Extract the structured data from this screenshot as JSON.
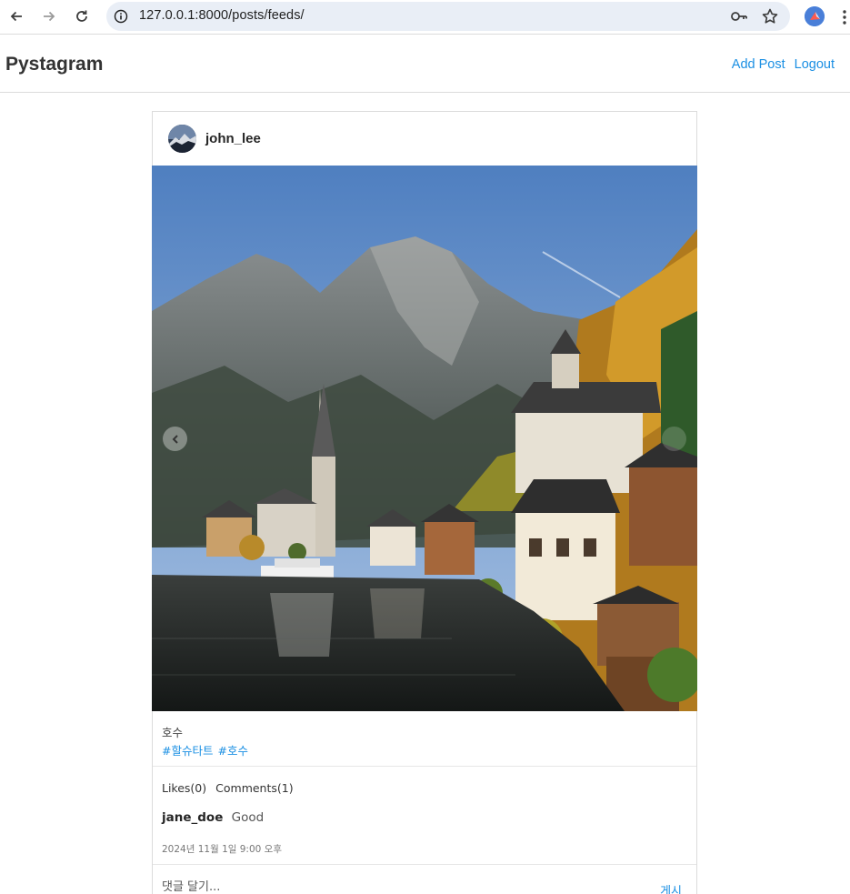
{
  "browser": {
    "url": "127.0.0.1:8000/posts/feeds/",
    "icons": [
      "back-arrow-icon",
      "forward-arrow-icon",
      "reload-icon",
      "site-info-icon",
      "password-key-icon",
      "bookmark-star-icon",
      "profile-avatar-icon",
      "menu-dots-icon"
    ]
  },
  "navbar": {
    "brand": "Pystagram",
    "links": [
      "Add Post",
      "Logout"
    ]
  },
  "post": {
    "username": "john_lee",
    "caption": "호수",
    "tags": [
      "#할슈타트",
      "#호수"
    ],
    "likes_label": "Likes(0)",
    "comments_label": "Comments(1)",
    "comments": [
      {
        "user": "jane_doe",
        "text": "Good"
      }
    ],
    "timestamp": "2024년 11월 1일 9:00 오후",
    "comment_placeholder": "댓글 달기...",
    "submit_label": "게시"
  },
  "colors": {
    "link": "#1a8fe3",
    "border": "#dbdbdb",
    "omnibox": "#e9eef6"
  }
}
